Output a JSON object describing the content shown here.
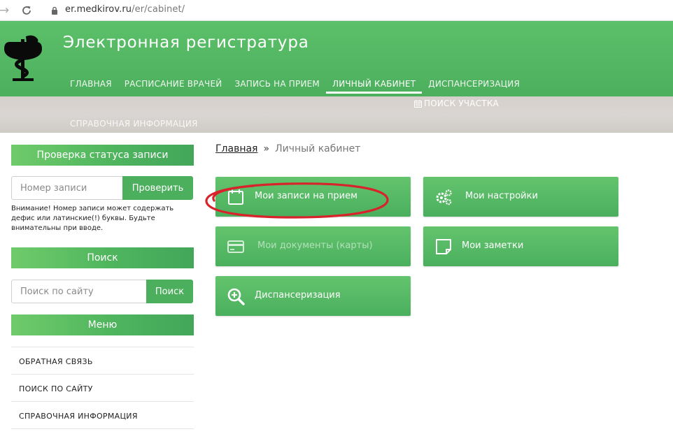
{
  "browser": {
    "url_host": "er.medkirov.ru",
    "url_path": "/er/cabinet/"
  },
  "header": {
    "title": "Электронная регистратура",
    "nav": [
      {
        "label": "ГЛАВНАЯ"
      },
      {
        "label": "РАСПИСАНИЕ ВРАЧЕЙ"
      },
      {
        "label": "ЗАПИСЬ НА ПРИЕМ"
      },
      {
        "label": "ЛИЧНЫЙ КАБИНЕТ",
        "active": true
      },
      {
        "label": "ДИСПАНСЕРИЗАЦИЯ"
      }
    ],
    "secondary": {
      "district_search": "ПОИСК УЧАСТКА",
      "reference": "СПРАВОЧНАЯ ИНФОРМАЦИЯ"
    }
  },
  "sidebar": {
    "status_check": {
      "title": "Проверка статуса записи",
      "placeholder": "Номер записи",
      "button": "Проверить",
      "notice": "Внимание! Номер записи может содержать\nдефис или латинские(!) буквы. Будьте\nвнимательны при вводе."
    },
    "search": {
      "title": "Поиск",
      "placeholder": "Поиск по сайту",
      "button": "Поиск"
    },
    "menu": {
      "title": "Меню",
      "items": [
        {
          "label": "ОБРАТНАЯ СВЯЗЬ"
        },
        {
          "label": "ПОИСК ПО САЙТУ"
        },
        {
          "label": "СПРАВОЧНАЯ ИНФОРМАЦИЯ"
        }
      ]
    }
  },
  "main": {
    "breadcrumb": {
      "home": "Главная",
      "separator": "»",
      "current": "Личный кабинет"
    },
    "tiles": [
      {
        "label": "Мои записи на прием",
        "icon": "calendar-icon"
      },
      {
        "label": "Мои настройки",
        "icon": "gears-icon"
      },
      {
        "label": "Мои документы (карты)",
        "icon": "card-icon",
        "disabled": true
      },
      {
        "label": "Мои заметки",
        "icon": "note-icon"
      },
      {
        "label": "Диспансеризация",
        "icon": "search-plus-icon"
      }
    ]
  },
  "colors": {
    "brand_green": "#4caf5d",
    "annotation_red": "#d9232a"
  }
}
